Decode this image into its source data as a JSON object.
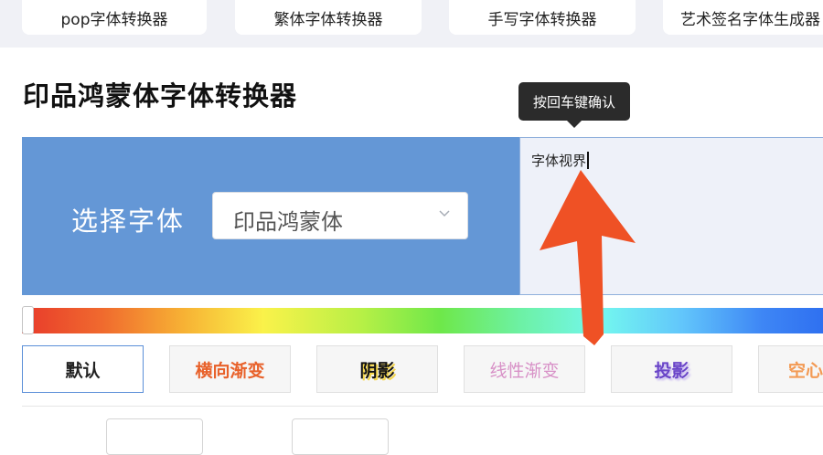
{
  "nav": {
    "items": [
      {
        "label": "pop字体转换器"
      },
      {
        "label": "繁体字体转换器"
      },
      {
        "label": "手写字体转换器"
      },
      {
        "label": "艺术签名字体生成器"
      }
    ]
  },
  "page": {
    "title": "印品鸿蒙体字体转换器"
  },
  "tooltip": {
    "text": "按回车键确认"
  },
  "font_picker": {
    "label": "选择字体",
    "selected": "印品鸿蒙体"
  },
  "text_input": {
    "value": "字体视界"
  },
  "color_slider": {
    "value": 0.0
  },
  "styles": {
    "items": [
      {
        "label": "默认",
        "active": true
      },
      {
        "label": "横向渐变"
      },
      {
        "label": "阴影"
      },
      {
        "label": "线性渐变"
      },
      {
        "label": "投影"
      },
      {
        "label": "空心"
      }
    ]
  },
  "annotation": {
    "arrow_color": "#ef5125"
  },
  "colors": {
    "panel_blue": "#6497d6",
    "active_border": "#5b8fd8",
    "tooltip_bg": "#2b2b2b"
  }
}
